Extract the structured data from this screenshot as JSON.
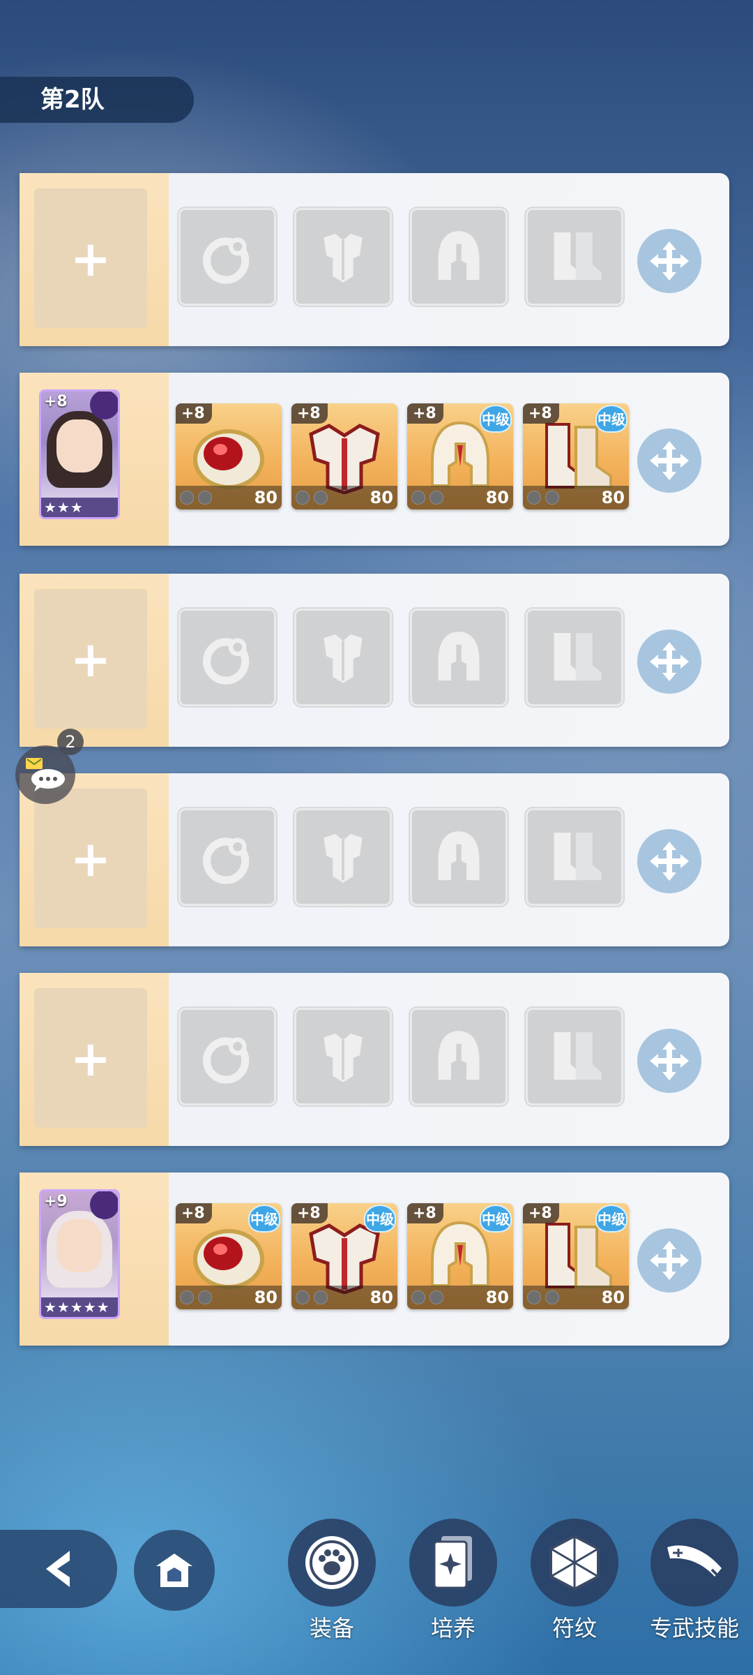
{
  "team": {
    "label": "第2队"
  },
  "rows": [
    {
      "empty": true,
      "hero_add": "+"
    },
    {
      "empty": false,
      "hero": {
        "level": "+8",
        "stars": "★★★"
      },
      "gear": [
        {
          "type": "ring",
          "plus": "+8",
          "grade": "",
          "level": "80"
        },
        {
          "type": "armor",
          "plus": "+8",
          "grade": "",
          "level": "80"
        },
        {
          "type": "helmet",
          "plus": "+8",
          "grade": "中级",
          "level": "80"
        },
        {
          "type": "boots",
          "plus": "+8",
          "grade": "中级",
          "level": "80"
        }
      ]
    },
    {
      "empty": true,
      "hero_add": "+"
    },
    {
      "empty": true,
      "hero_add": "+"
    },
    {
      "empty": true,
      "hero_add": "+"
    },
    {
      "empty": false,
      "hero": {
        "level": "+9",
        "stars": "★★★★★"
      },
      "gear": [
        {
          "type": "ring",
          "plus": "+8",
          "grade": "中级",
          "level": "80"
        },
        {
          "type": "armor",
          "plus": "+8",
          "grade": "中级",
          "level": "80"
        },
        {
          "type": "helmet",
          "plus": "+8",
          "grade": "中级",
          "level": "80"
        },
        {
          "type": "boots",
          "plus": "+8",
          "grade": "中级",
          "level": "80"
        }
      ]
    }
  ],
  "chat": {
    "badge": "2"
  },
  "bottom_nav": {
    "equip": "装备",
    "train": "培养",
    "rune": "符纹",
    "skill": "专武技能"
  }
}
